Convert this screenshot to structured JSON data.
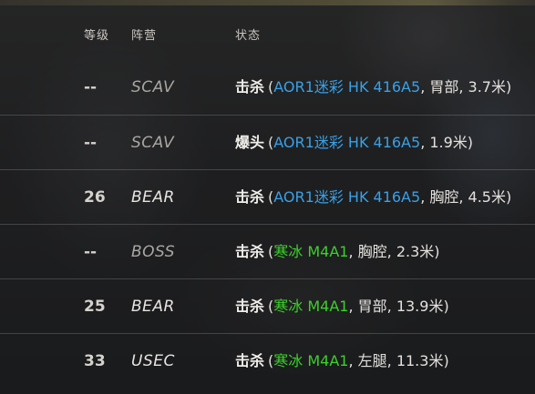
{
  "colors": {
    "weapon_blue": "#3aa0e6",
    "weapon_green": "#3bd12a"
  },
  "headers": {
    "level": "等级",
    "faction": "阵营",
    "status": "状态"
  },
  "rows": [
    {
      "level": "--",
      "faction": "SCAV",
      "verb": "击杀",
      "open": "(",
      "weapon": "AOR1迷彩 HK 416A5",
      "weapon_color": "blue",
      "rest": ", 胃部, 3.7米)"
    },
    {
      "level": "--",
      "faction": "SCAV",
      "verb": "爆头",
      "open": "(",
      "weapon": "AOR1迷彩 HK 416A5",
      "weapon_color": "blue",
      "rest": ", 1.9米)"
    },
    {
      "level": "26",
      "faction": "BEAR",
      "verb": "击杀",
      "open": "(",
      "weapon": "AOR1迷彩 HK 416A5",
      "weapon_color": "blue",
      "rest": ", 胸腔, 4.5米)"
    },
    {
      "level": "--",
      "faction": "BOSS",
      "verb": "击杀",
      "open": "(",
      "weapon": "寒冰 M4A1",
      "weapon_color": "green",
      "rest": ", 胸腔, 2.3米)"
    },
    {
      "level": "25",
      "faction": "BEAR",
      "verb": "击杀",
      "open": "(",
      "weapon": "寒冰 M4A1",
      "weapon_color": "green",
      "rest": ", 胃部, 13.9米)"
    },
    {
      "level": "33",
      "faction": "USEC",
      "verb": "击杀",
      "open": "(",
      "weapon": "寒冰 M4A1",
      "weapon_color": "green",
      "rest": ", 左腿, 11.3米)"
    }
  ]
}
